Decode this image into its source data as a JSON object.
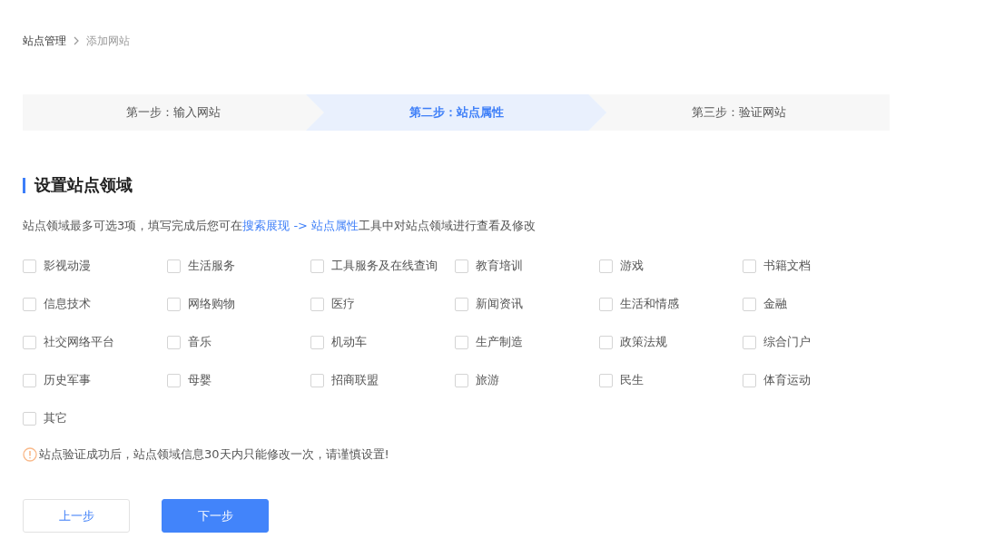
{
  "breadcrumb": [
    {
      "label": "站点管理",
      "selected": false
    },
    {
      "label": "添加网站",
      "selected": true
    }
  ],
  "steps": [
    {
      "label": "第一步：输入网站",
      "selected": false
    },
    {
      "label": "第二步：站点属性",
      "selected": true
    },
    {
      "label": "第三步：验证网站",
      "selected": false
    }
  ],
  "section_title": "设置站点领域",
  "description": {
    "before": "站点领域最多可选3项，填写完成后您可在",
    "link": "搜索展现 -> 站点属性",
    "after": "工具中对站点领域进行查看及修改"
  },
  "domains": [
    {
      "label": "影视动漫",
      "checked": false
    },
    {
      "label": "生活服务",
      "checked": false
    },
    {
      "label": "工具服务及在线查询",
      "checked": false
    },
    {
      "label": "教育培训",
      "checked": false
    },
    {
      "label": "游戏",
      "checked": false
    },
    {
      "label": "书籍文档",
      "checked": false
    },
    {
      "label": "信息技术",
      "checked": false
    },
    {
      "label": "网络购物",
      "checked": false
    },
    {
      "label": "医疗",
      "checked": false
    },
    {
      "label": "新闻资讯",
      "checked": false
    },
    {
      "label": "生活和情感",
      "checked": false
    },
    {
      "label": "金融",
      "checked": false
    },
    {
      "label": "社交网络平台",
      "checked": false
    },
    {
      "label": "音乐",
      "checked": false
    },
    {
      "label": "机动车",
      "checked": false
    },
    {
      "label": "生产制造",
      "checked": false
    },
    {
      "label": "政策法规",
      "checked": false
    },
    {
      "label": "综合门户",
      "checked": false
    },
    {
      "label": "历史军事",
      "checked": false
    },
    {
      "label": "母婴",
      "checked": false
    },
    {
      "label": "招商联盟",
      "checked": false
    },
    {
      "label": "旅游",
      "checked": false
    },
    {
      "label": "民生",
      "checked": false
    },
    {
      "label": "体育运动",
      "checked": false
    },
    {
      "label": "其它",
      "checked": false
    }
  ],
  "warning": "站点验证成功后，站点领域信息30天内只能修改一次，请谨慎设置!",
  "buttons": [
    {
      "label": "上一步",
      "kind": "secondary"
    },
    {
      "label": "下一步",
      "kind": "primary"
    }
  ]
}
